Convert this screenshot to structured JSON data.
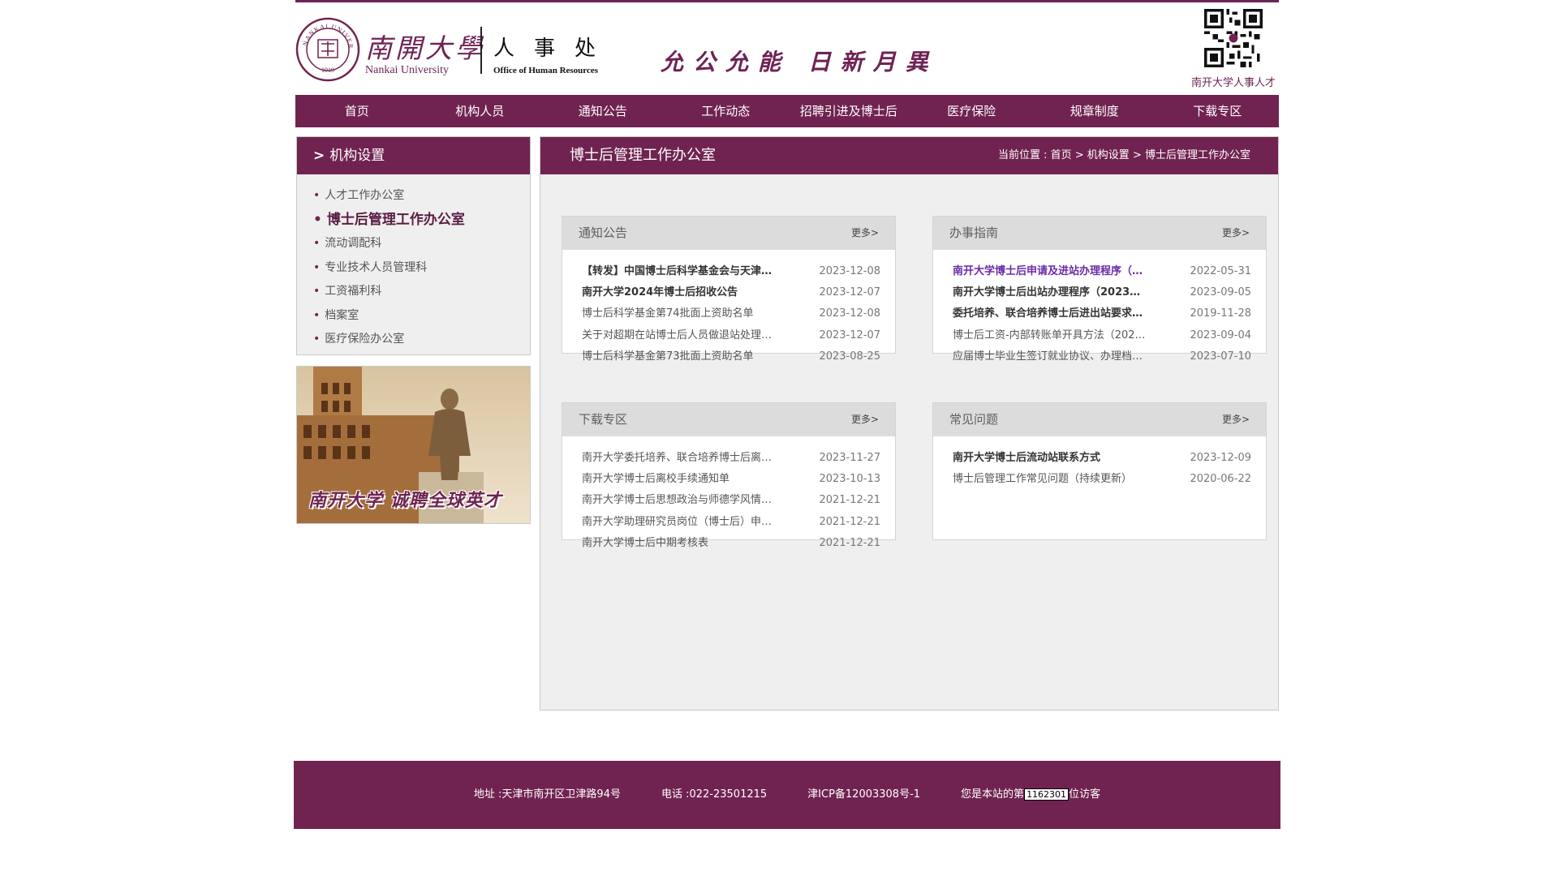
{
  "header": {
    "university_cn": "南開大學",
    "university_en": "Nankai University",
    "seal_text": "NANKAI UNIVERSITY",
    "seal_year": "1919",
    "department_cn": "人事处",
    "department_en": "Office of Human Resources",
    "motto": "允公允能 日新月異",
    "qr_caption": "南开大学人事人才"
  },
  "nav": {
    "items": [
      "首页",
      "机构人员",
      "通知公告",
      "工作动态",
      "招聘引进及博士后",
      "医疗保险",
      "规章制度",
      "下载专区"
    ]
  },
  "sidebar": {
    "title": "机构设置",
    "chevron": ">",
    "items": [
      {
        "label": "人才工作办公室"
      },
      {
        "label": "博士后管理工作办公室",
        "active": true
      },
      {
        "label": "流动调配科"
      },
      {
        "label": "专业技术人员管理科"
      },
      {
        "label": "工资福利科"
      },
      {
        "label": "档案室"
      },
      {
        "label": "医疗保险办公室"
      }
    ],
    "photo_caption": "南开大学 诚聘全球英才"
  },
  "main": {
    "title": "博士后管理工作办公室",
    "breadcrumb": {
      "prefix": "当前位置 : ",
      "home": "首页",
      "sep": " > ",
      "level1": "机构设置",
      "current": "博士后管理工作办公室"
    },
    "boxes": [
      {
        "title": "通知公告",
        "more": "更多>",
        "rows": [
          {
            "title": "【转发】中国博士后科学基金会与天津…",
            "date": "2023-12-08",
            "style": "b"
          },
          {
            "title": "南开大学2024年博士后招收公告",
            "date": "2023-12-07",
            "style": "b"
          },
          {
            "title": "博士后科学基金第74批面上资助名单",
            "date": "2023-12-08",
            "style": ""
          },
          {
            "title": "关于对超期在站博士后人员做退站处理…",
            "date": "2023-12-07",
            "style": ""
          },
          {
            "title": "博士后科学基金第73批面上资助名单",
            "date": "2023-08-25",
            "style": ""
          }
        ]
      },
      {
        "title": "办事指南",
        "more": "更多>",
        "rows": [
          {
            "title": "南开大学博士后申请及进站办理程序（…",
            "date": "2022-05-31",
            "style": "hl"
          },
          {
            "title": "南开大学博士后出站办理程序（2023…",
            "date": "2023-09-05",
            "style": "b"
          },
          {
            "title": "委托培养、联合培养博士后进出站要求…",
            "date": "2019-11-28",
            "style": "b"
          },
          {
            "title": "博士后工资-内部转账单开具方法（202…",
            "date": "2023-09-04",
            "style": ""
          },
          {
            "title": "应届博士毕业生签订就业协议、办理档…",
            "date": "2023-07-10",
            "style": ""
          }
        ]
      },
      {
        "title": "下载专区",
        "more": "更多>",
        "rows": [
          {
            "title": "南开大学委托培养、联合培养博士后离…",
            "date": "2023-11-27",
            "style": ""
          },
          {
            "title": "南开大学博士后离校手续通知单",
            "date": "2023-10-13",
            "style": ""
          },
          {
            "title": "南开大学博士后思想政治与师德学风情…",
            "date": "2021-12-21",
            "style": ""
          },
          {
            "title": "南开大学助理研究员岗位（博士后）申…",
            "date": "2021-12-21",
            "style": ""
          },
          {
            "title": "南开大学博士后中期考核表",
            "date": "2021-12-21",
            "style": ""
          }
        ]
      },
      {
        "title": "常见问题",
        "more": "更多>",
        "rows": [
          {
            "title": "南开大学博士后流动站联系方式",
            "date": "2023-12-09",
            "style": "b"
          },
          {
            "title": "博士后管理工作常见问题（持续更新）",
            "date": "2020-06-22",
            "style": ""
          }
        ]
      }
    ]
  },
  "footer": {
    "address": "地址 :天津市南开区卫津路94号",
    "phone": "电话 :022-23501215",
    "icp": "津ICP备12003308号-1",
    "visitor_prefix": "您是本站的第",
    "visitor_count": "1162301",
    "visitor_suffix": "位访客"
  },
  "colors": {
    "brand": "#702350",
    "panel_bg": "#f0eff0",
    "box_head": "#dcdcdc",
    "link_highlight": "#6a2aa8"
  }
}
